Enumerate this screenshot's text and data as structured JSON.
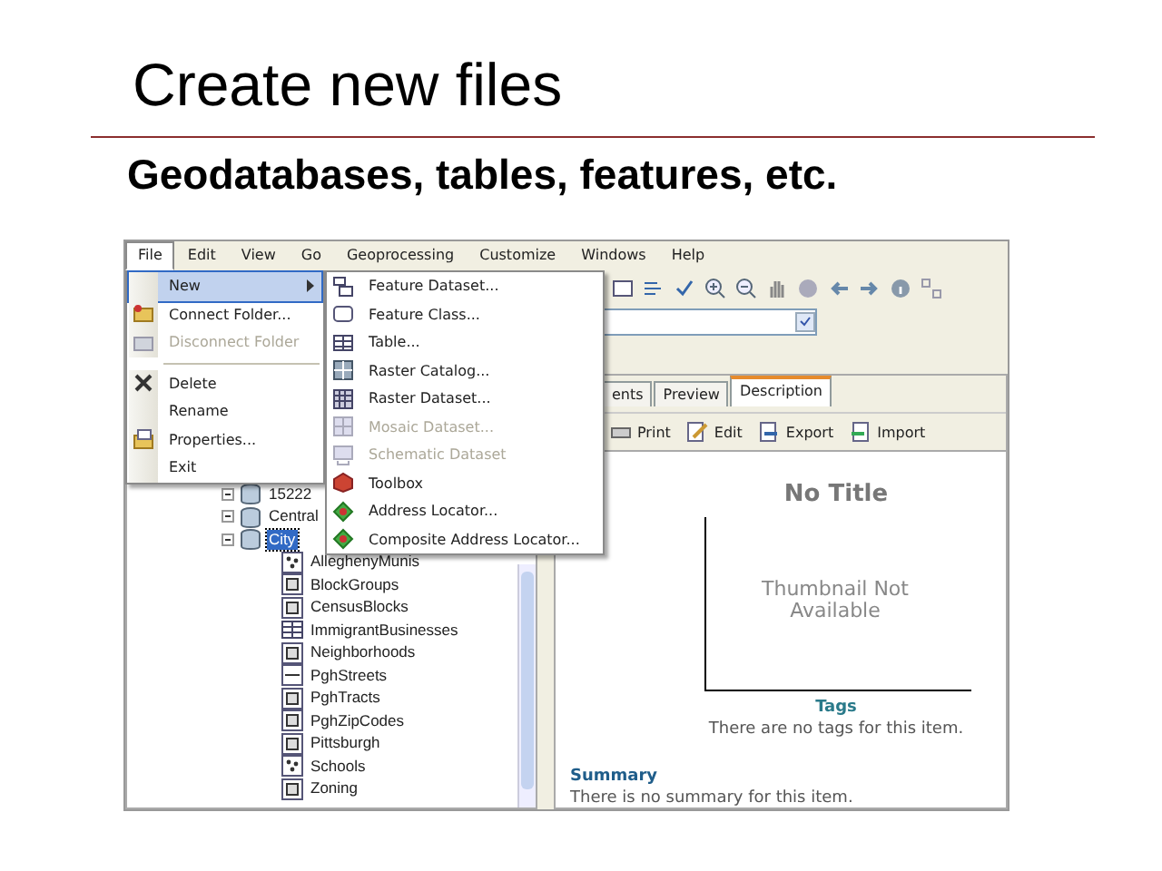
{
  "slide": {
    "title": "Create new files",
    "subtitle": "Geodatabases, tables, features, etc."
  },
  "menu_bar": [
    {
      "label": "File",
      "selected": true
    },
    {
      "label": "Edit",
      "selected": false
    },
    {
      "label": "View",
      "selected": false
    },
    {
      "label": "Go",
      "selected": false
    },
    {
      "label": "Geoprocessing",
      "selected": false
    },
    {
      "label": "Customize",
      "selected": false
    },
    {
      "label": "Windows",
      "selected": false
    },
    {
      "label": "Help",
      "selected": false
    }
  ],
  "file_menu": [
    {
      "kind": "submenu",
      "label": "New",
      "selected": true,
      "disabled": false
    },
    {
      "kind": "item",
      "label": "Connect Folder...",
      "selected": false,
      "disabled": false
    },
    {
      "kind": "item",
      "label": "Disconnect Folder",
      "selected": false,
      "disabled": true
    },
    {
      "kind": "separator"
    },
    {
      "kind": "item",
      "label": "Delete",
      "selected": false,
      "disabled": false
    },
    {
      "kind": "item",
      "label": "Rename",
      "selected": false,
      "disabled": false
    },
    {
      "kind": "item",
      "label": "Properties...",
      "selected": false,
      "disabled": false
    },
    {
      "kind": "item",
      "label": "Exit",
      "selected": false,
      "disabled": false
    }
  ],
  "new_submenu": [
    {
      "label": "Feature Dataset...",
      "disabled": false
    },
    {
      "label": "Feature Class...",
      "disabled": false
    },
    {
      "label": "Table...",
      "disabled": false
    },
    {
      "label": "Raster Catalog...",
      "disabled": false
    },
    {
      "label": "Raster Dataset...",
      "disabled": false
    },
    {
      "label": "Mosaic Dataset...",
      "disabled": true
    },
    {
      "label": "Schematic Dataset",
      "disabled": true
    },
    {
      "label": "Toolbox",
      "disabled": false
    },
    {
      "label": "Address Locator...",
      "disabled": false
    },
    {
      "label": "Composite Address Locator...",
      "disabled": false
    }
  ],
  "catalog_tree": [
    {
      "kind": "geodatabase",
      "label": "15222",
      "selected": false
    },
    {
      "kind": "geodatabase",
      "label": "Central",
      "selected": false
    },
    {
      "kind": "geodatabase",
      "label": "City",
      "selected": true,
      "children": [
        {
          "kind": "point",
          "label": "AlleghenyMunis",
          "selected": false
        },
        {
          "kind": "polygon",
          "label": "BlockGroups",
          "selected": false
        },
        {
          "kind": "polygon",
          "label": "CensusBlocks",
          "selected": false
        },
        {
          "kind": "table",
          "label": "ImmigrantBusinesses",
          "selected": false
        },
        {
          "kind": "polygon",
          "label": "Neighborhoods",
          "selected": false
        },
        {
          "kind": "line",
          "label": "PghStreets",
          "selected": false
        },
        {
          "kind": "polygon",
          "label": "PghTracts",
          "selected": false
        },
        {
          "kind": "polygon",
          "label": "PghZipCodes",
          "selected": false
        },
        {
          "kind": "polygon",
          "label": "Pittsburgh",
          "selected": false
        },
        {
          "kind": "point",
          "label": "Schools",
          "selected": false
        },
        {
          "kind": "polygon",
          "label": "Zoning",
          "selected": false
        }
      ]
    }
  ],
  "tabs": [
    {
      "label": "ents",
      "selected": false
    },
    {
      "label": "Preview",
      "selected": false
    },
    {
      "label": "Description",
      "selected": true
    }
  ],
  "description_toolbar": [
    "Print",
    "Edit",
    "Export",
    "Import"
  ],
  "description": {
    "title": "No Title",
    "thumbnail": "Thumbnail Not Available",
    "tags_heading": "Tags",
    "tags_text": "There are no tags for this item.",
    "summary_heading": "Summary",
    "summary_text": "There is no summary for this item."
  }
}
